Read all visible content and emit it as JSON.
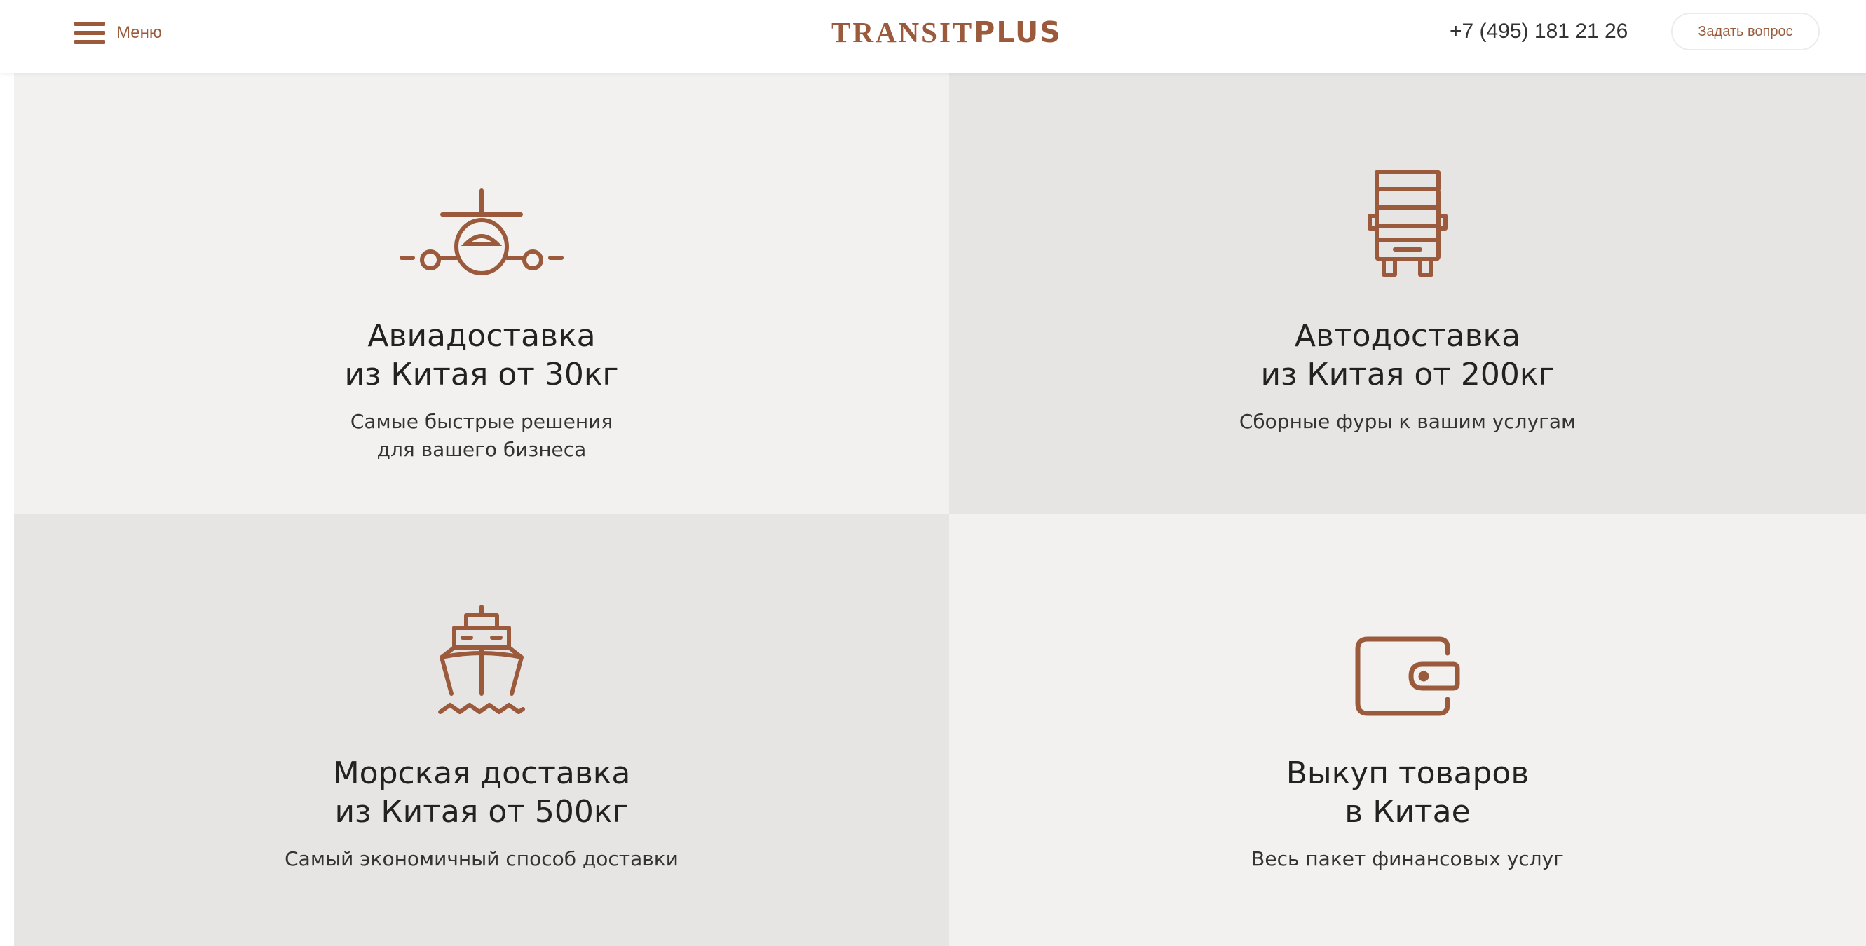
{
  "header": {
    "menu_label": "Меню",
    "logo_part1": "TRANSIT",
    "logo_part2": "PLUS",
    "phone": "+7 (495) 181 21 26",
    "ask_button": "Задать вопрос"
  },
  "colors": {
    "accent": "#9b5a3c",
    "tile_light": "#f2f1f0",
    "tile_dark": "#e6e5e4"
  },
  "services": [
    {
      "icon": "airplane-icon",
      "title_line1": "Авиадоставка",
      "title_line2": "из Китая от 30кг",
      "desc_line1": "Самые быстрые решения",
      "desc_line2": "для вашего бизнеса"
    },
    {
      "icon": "truck-icon",
      "title_line1": "Автодоставка",
      "title_line2": "из Китая от 200кг",
      "desc_line1": "Сборные фуры к вашим услугам"
    },
    {
      "icon": "ship-icon",
      "title_line1": "Морская доставка",
      "title_line2": "из Китая от 500кг",
      "desc_line1": "Самый экономичный способ доставки"
    },
    {
      "icon": "wallet-icon",
      "title_line1": "Выкуп товаров",
      "title_line2": "в Китае",
      "desc_line1": "Весь пакет финансовых услуг"
    }
  ]
}
